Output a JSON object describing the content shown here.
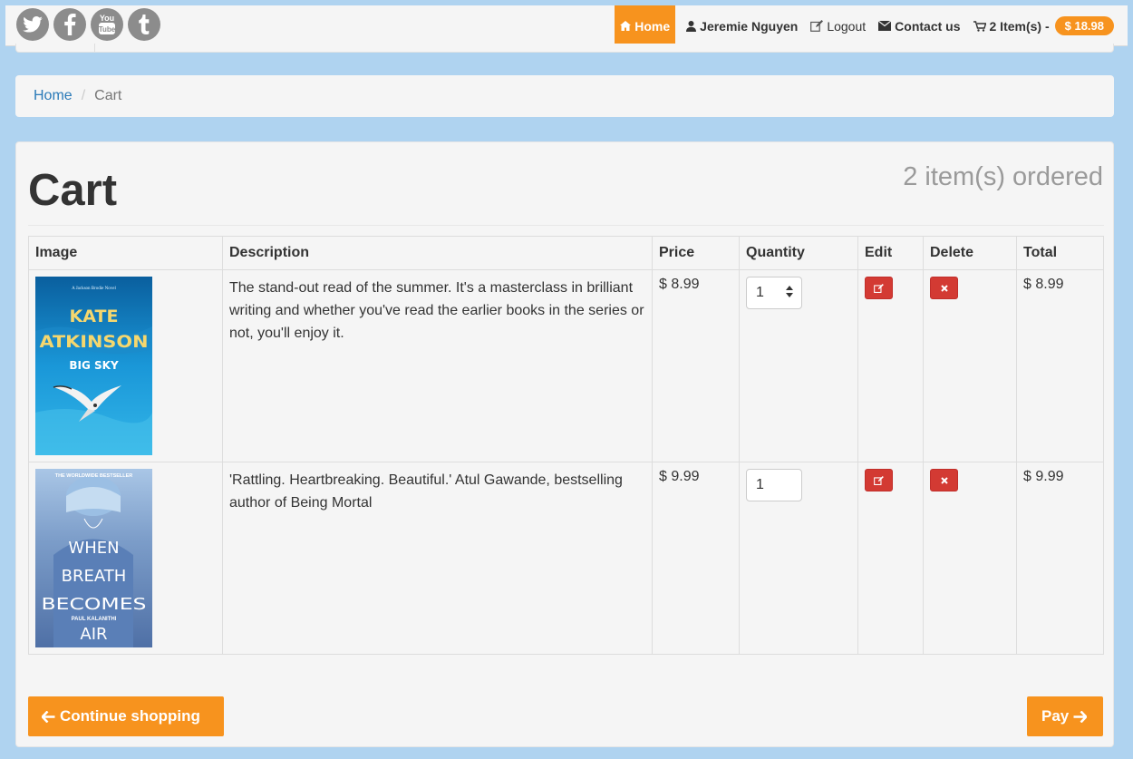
{
  "header": {
    "social": [
      {
        "icon": "twitter-icon"
      },
      {
        "icon": "facebook-icon"
      },
      {
        "icon": "youtube-icon"
      },
      {
        "icon": "tumblr-icon"
      }
    ],
    "nav": {
      "home": "Home",
      "user": "Jeremie Nguyen",
      "logout": "Logout",
      "contact": "Contact us",
      "cart": "2 Item(s) -",
      "cart_total": "$ 18.98"
    }
  },
  "breadcrumb": {
    "home": "Home",
    "separator": "/",
    "current": "Cart"
  },
  "main": {
    "title": "Cart",
    "ordered": "2 item(s) ordered",
    "columns": [
      "Image",
      "Description",
      "Price",
      "Quantity",
      "Edit",
      "Delete",
      "Total"
    ],
    "rows": [
      {
        "cover_author": "KATE ATKINSON",
        "cover_author_1": "KATE",
        "cover_author_2": "ATKINSON",
        "cover_title": "BIG SKY",
        "cover_tagline": "A Jackson Brodie Novel",
        "description": "The stand-out read of the summer. It's a masterclass in brilliant writing and whether you've read the earlier books in the series or not, you'll enjoy it.",
        "price": "$ 8.99",
        "quantity": "1",
        "total": "$ 8.99"
      },
      {
        "cover_top": "THE WORLDWIDE BESTSELLER",
        "cover_title_1": "WHEN",
        "cover_title_2": "BREATH",
        "cover_title_3": "BECOMES",
        "cover_title_4": "AIR",
        "cover_author": "PAUL KALANITHI",
        "description": "'Rattling. Heartbreaking. Beautiful.' Atul Gawande, bestselling author of Being Mortal",
        "price": "$ 9.99",
        "quantity": "1",
        "total": "$ 9.99"
      }
    ]
  },
  "actions": {
    "continue": "Continue shopping",
    "pay": "Pay"
  },
  "colors": {
    "accent": "#f7931e",
    "danger": "#d33a33",
    "link": "#2a7ab8",
    "background": "#afd3f0"
  }
}
